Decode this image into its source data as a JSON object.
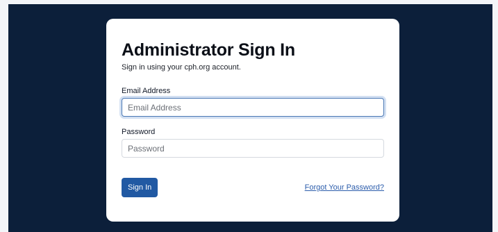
{
  "page": {
    "title": "Administrator Sign In",
    "subtitle": "Sign in using your cph.org account."
  },
  "form": {
    "email": {
      "label": "Email Address",
      "placeholder": "Email Address",
      "value": ""
    },
    "password": {
      "label": "Password",
      "placeholder": "Password",
      "value": ""
    },
    "submit_label": "Sign In",
    "forgot_password_label": "Forgot Your Password?"
  },
  "colors": {
    "background": "#0c1f3a",
    "card": "#ffffff",
    "primary_button": "#2159a3",
    "link": "#2b5cab",
    "focus_ring": "#4a78b4"
  }
}
